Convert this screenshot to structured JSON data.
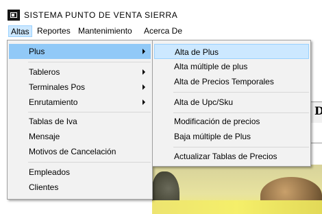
{
  "window": {
    "title": "SISTEMA  PUNTO  DE  VENTA  SIERRA",
    "icon": "app-logo-icon"
  },
  "menubar": {
    "items": [
      {
        "label": "Altas"
      },
      {
        "label": "Reportes"
      },
      {
        "label": "Mantenimiento"
      },
      {
        "label": "Acerca De"
      }
    ]
  },
  "altas_menu": {
    "items": [
      {
        "label": "Plus"
      },
      {
        "label": "Tableros"
      },
      {
        "label": "Terminales Pos"
      },
      {
        "label": "Enrutamiento"
      },
      {
        "label": "Tablas de Iva"
      },
      {
        "label": "Mensaje"
      },
      {
        "label": "Motivos de Cancelación"
      },
      {
        "label": "Empleados"
      },
      {
        "label": "Clientes"
      }
    ]
  },
  "plus_submenu": {
    "items": [
      {
        "label": "Alta de Plus"
      },
      {
        "label": "Alta múltiple de plus"
      },
      {
        "label": "Alta de Precios Temporales"
      },
      {
        "label": "Alta de Upc/Sku"
      },
      {
        "label": "Modificación de precios"
      },
      {
        "label": "Baja múltiple de Plus"
      },
      {
        "label": "Actualizar Tablas de Precios"
      }
    ]
  },
  "background": {
    "banner_letter": "D"
  },
  "colors": {
    "menu_highlight": "#91c9f7",
    "menu_hover": "#cce8ff",
    "menu_bg": "#f2f2f2"
  }
}
